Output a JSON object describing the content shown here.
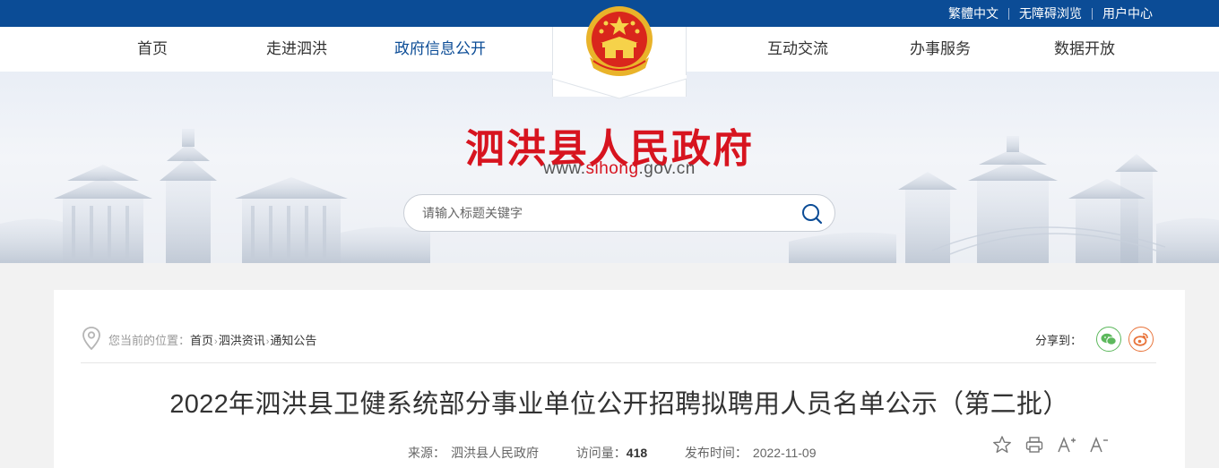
{
  "topbar": {
    "links": [
      "繁體中文",
      "无障碍浏览",
      "用户中心"
    ]
  },
  "nav": {
    "items": [
      "首页",
      "走进泗洪",
      "政府信息公开",
      "互动交流",
      "办事服务",
      "数据开放"
    ],
    "active_index": 2
  },
  "banner": {
    "title": "泗洪县人民政府",
    "url_prefix": "www.",
    "url_highlight": "sihong",
    "url_suffix": ".gov.cn"
  },
  "search": {
    "placeholder": "请输入标题关键字"
  },
  "breadcrumb": {
    "prefix": "您当前的位置：",
    "items": [
      "首页",
      "泗洪资讯",
      "通知公告"
    ],
    "separator": "›"
  },
  "share": {
    "label": "分享到："
  },
  "article": {
    "title": "2022年泗洪县卫健系统部分事业单位公开招聘拟聘用人员名单公示（第二批）",
    "source_label": "来源：",
    "source_value": "泗洪县人民政府",
    "views_label": "访问量：",
    "views_value": "418",
    "date_label": "发布时间：",
    "date_value": "2022-11-09"
  },
  "colors": {
    "brand_blue": "#0b4c96",
    "title_red": "#d7141f",
    "wechat_green": "#5cb85c",
    "weibo_orange": "#e8743b"
  },
  "icons": [
    "emblem-icon",
    "search-icon",
    "location-pin-icon",
    "wechat-icon",
    "weibo-icon",
    "star-icon",
    "print-icon",
    "font-increase-icon",
    "font-decrease-icon"
  ]
}
